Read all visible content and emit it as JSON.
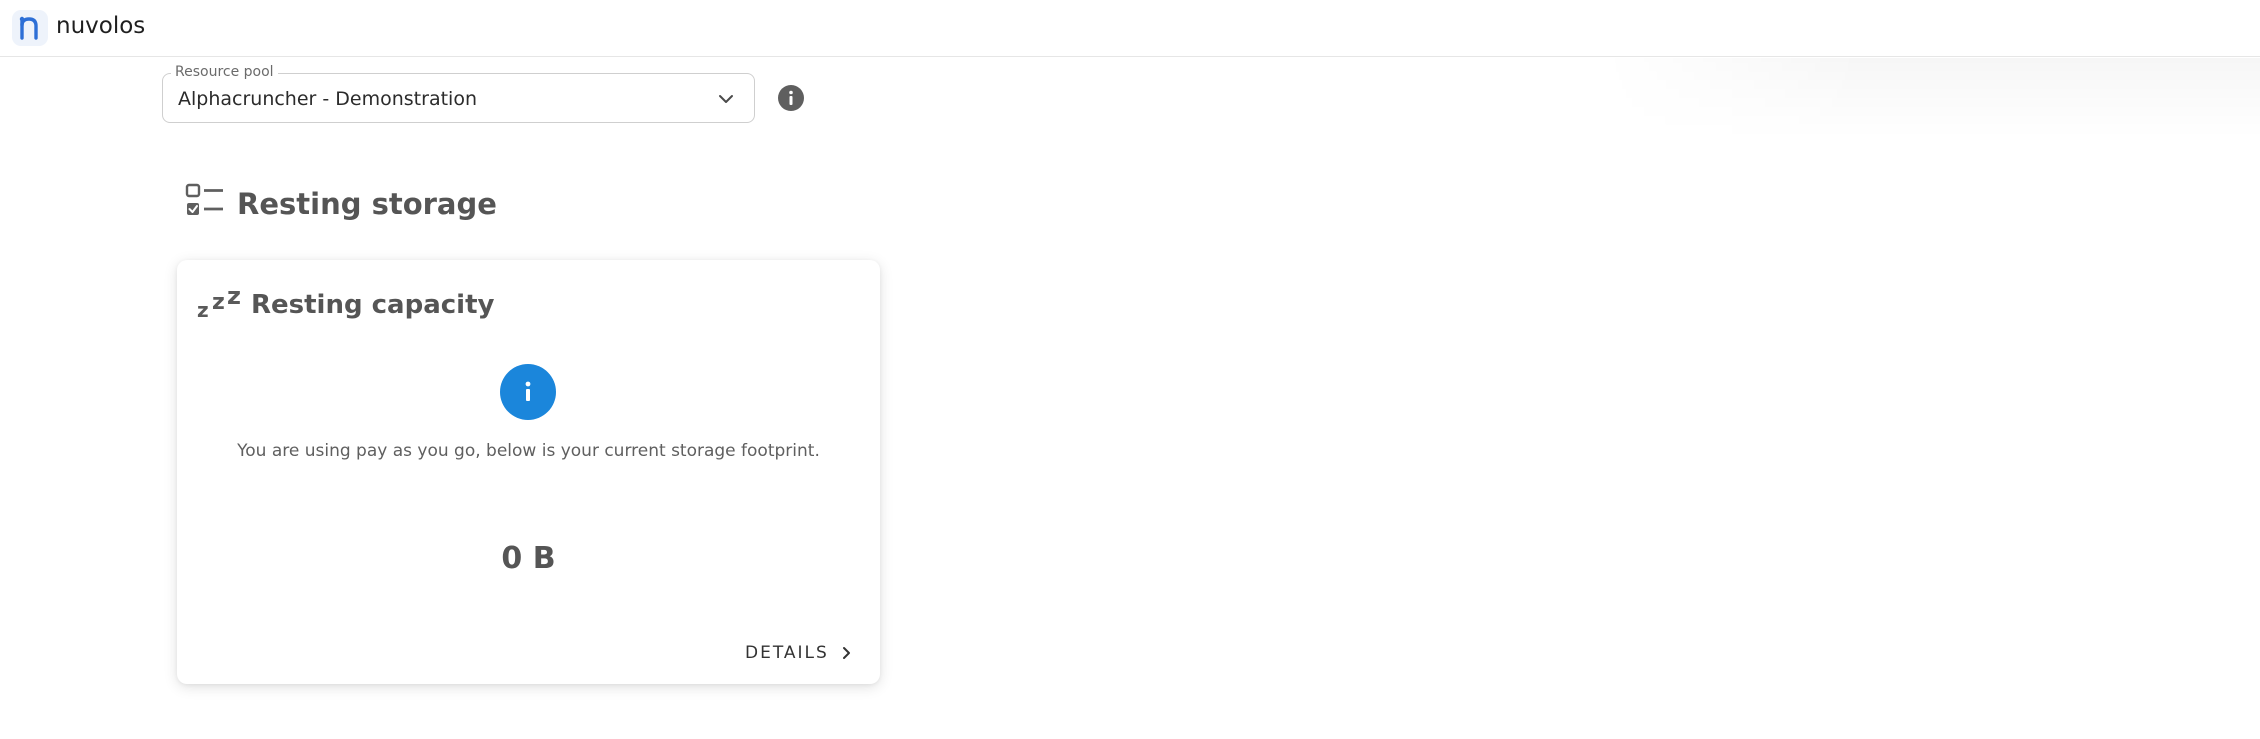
{
  "app": {
    "name": "nuvolos",
    "logo_icon": "nuvolos-logo-icon"
  },
  "resource_pool": {
    "label": "Resource pool",
    "selected": "Alphacruncher - Demonstration",
    "chevron_icon": "chevron-down-icon",
    "info_icon": "info-icon"
  },
  "section": {
    "title": "Resting storage",
    "icon": "checklist-icon"
  },
  "card": {
    "icon": "zzz-sleep-icon",
    "title": "Resting capacity",
    "info_icon": "info-circle-icon",
    "message": "You are using pay as you go, below is your current storage footprint.",
    "value": "0 B",
    "details_label": "DETAILS",
    "details_icon": "chevron-right-icon"
  },
  "colors": {
    "accent": "#1b86db",
    "logo_blue": "#2d6fd6",
    "text_dark": "#555555",
    "icon_gray": "#5f5f5f"
  }
}
